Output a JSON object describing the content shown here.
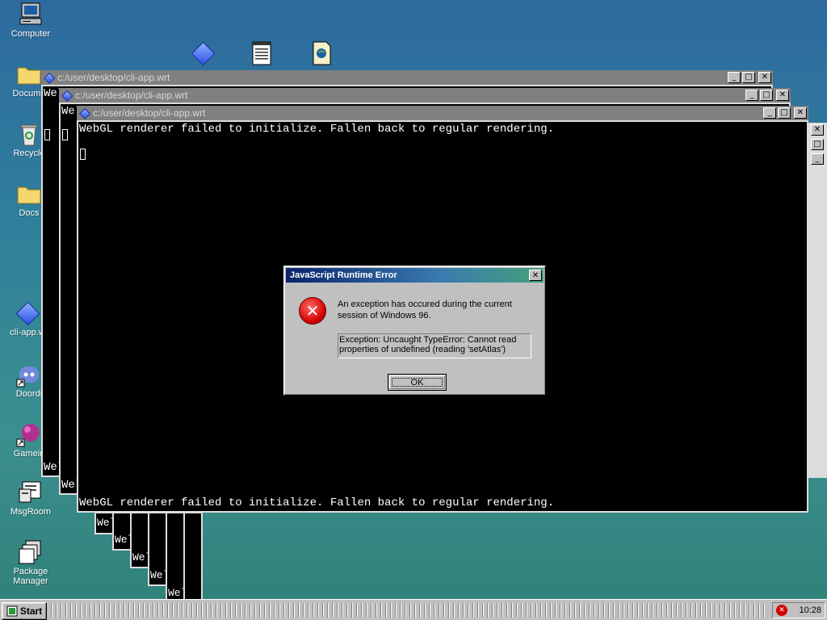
{
  "desktop": {
    "icons": [
      {
        "label": "Computer",
        "icon": "computer-icon"
      },
      {
        "label": "Docume",
        "icon": "folder-icon"
      },
      {
        "label": "Recycle",
        "icon": "recycle-bin-icon"
      },
      {
        "label": "Docs",
        "icon": "folder-icon"
      },
      {
        "label": "cli-app.w",
        "icon": "diamond-app-icon"
      },
      {
        "label": "Doordi",
        "icon": "discord-icon"
      },
      {
        "label": "Gamein",
        "icon": "game-icon"
      },
      {
        "label": "MsgRoom",
        "icon": "msgroom-icon"
      },
      {
        "label": "Package Manager",
        "icon": "package-icon"
      }
    ]
  },
  "windows": {
    "path": "c:/user/desktop/cli-app.wrt",
    "console_line": "WebGL renderer failed to initialize. Fallen back to regular rendering.",
    "stub_text": "Wel",
    "stub_text_alt": "Wel"
  },
  "dialog": {
    "title": "JavaScript Runtime Error",
    "message": "An exception has occured during the current session of Windows 96.",
    "exception": "Exception: Uncaught TypeError: Cannot read properties of undefined (reading 'setAtlas')",
    "ok_label": "OK",
    "close_glyph": "✕"
  },
  "taskbar": {
    "start_label": "Start",
    "clock": "10:28"
  },
  "colors": {
    "inactive_title": "#808080",
    "dialog_title_start": "#0a246a",
    "dialog_title_end": "#45a07a",
    "error_red": "#d40000"
  }
}
